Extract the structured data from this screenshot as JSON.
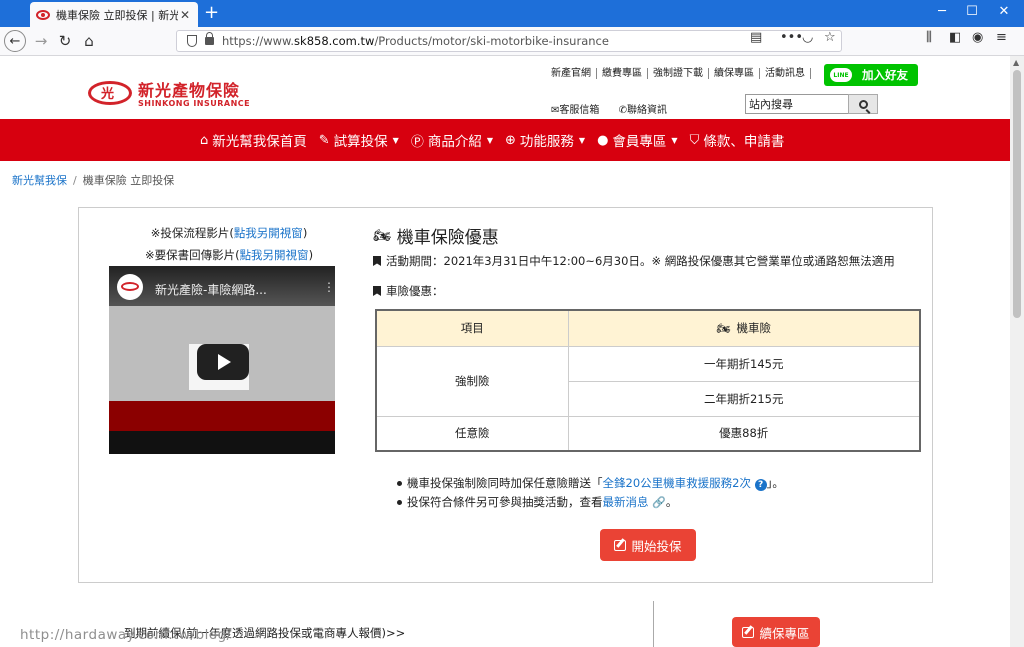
{
  "browser": {
    "tab_title": "機車保險 立即投保 | 新光產險",
    "url_prefix": "https://www.",
    "url_domain": "sk858.com.tw",
    "url_path": "/Products/motor/ski-motorbike-insurance",
    "close_label": "✕",
    "newtab_label": "+"
  },
  "header": {
    "logo_cn": "新光產物保險",
    "logo_en": "SHINKONG INSURANCE",
    "top_links": [
      "新產官網",
      "繳費專區",
      "強制證下載",
      "續保專區",
      "活動訊息"
    ],
    "line_button": "加入好友",
    "line_icon_text": "LINE",
    "service_link": "客服信箱",
    "contact_link": "聯絡資訊",
    "search_value": "站內搜尋"
  },
  "mainnav": [
    {
      "icon": "home-icon",
      "label": "新光幫我保首頁",
      "caret": false
    },
    {
      "icon": "edit-icon",
      "label": "試算投保",
      "caret": true
    },
    {
      "icon": "product-icon",
      "label": "商品介紹",
      "caret": true
    },
    {
      "icon": "plus-icon",
      "label": "功能服務",
      "caret": true
    },
    {
      "icon": "user-icon",
      "label": "會員專區",
      "caret": true
    },
    {
      "icon": "shield-icon",
      "label": "條款、申請書",
      "caret": false
    }
  ],
  "breadcrumb": {
    "home": "新光幫我保",
    "sep": "/",
    "current": "機車保險 立即投保"
  },
  "video_panel": {
    "line1_prefix": "※投保流程影片(",
    "line1_link": "點我另開視窗",
    "line1_suffix": ")",
    "line2_prefix": "※要保書回傳影片(",
    "line2_link": "點我另開視窗",
    "line2_suffix": ")",
    "video_title": "新光產險-車險網路..."
  },
  "promo": {
    "title": "機車保險優惠",
    "period": "活動期間：2021年3月31日中午12:00~6月30日。※ 網路投保優惠其它營業單位或通路恕無法適用",
    "subhead": "車險優惠："
  },
  "rates_table": {
    "headers": [
      "項目",
      "機車險"
    ],
    "compulsory_label": "強制險",
    "compulsory_rows": [
      "一年期折145元",
      "二年期折215元"
    ],
    "optional_label": "任意險",
    "optional_value": "優惠88折"
  },
  "notes": {
    "n1_prefix": "機車投保強制險同時加保任意險贈送「",
    "n1_link": "全鋒20公里機車救援服務2次",
    "n1_suffix": "」。",
    "n2_prefix": "投保符合條件另可參與抽獎活動，查看",
    "n2_link": "最新消息"
  },
  "buttons": {
    "start": "開始投保",
    "renew": "續保專區"
  },
  "bottom": {
    "renew_text": "到期前續保(前一年度透過網路投保或電商專人報價)>>"
  },
  "watermark": "http://hardaway.com.tw/blog/"
}
